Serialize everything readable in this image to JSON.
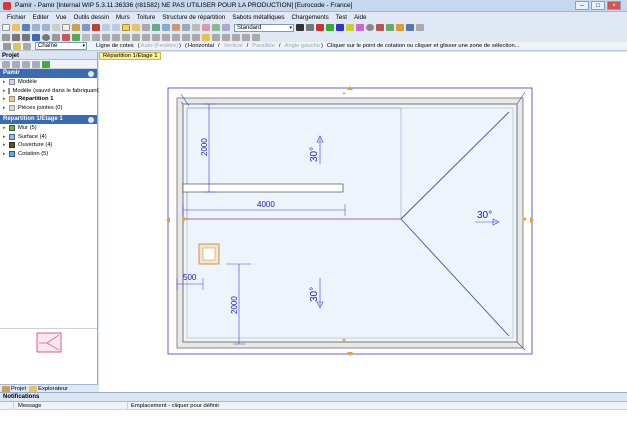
{
  "window": {
    "title": "Pamir - Pamir    [Internal WIP 5.3.11.36336 (r81582) NE PAS UTILISER POUR LA PRODUCTION]    [Eurocode - France]"
  },
  "menu": [
    "Fichier",
    "Editer",
    "Vue",
    "Outils dessin",
    "Murs",
    "Toiture",
    "Structure de répartition",
    "Sabots métalliques",
    "Chargements",
    "Test",
    "Aide"
  ],
  "toolbar": {
    "style_select": "Standard",
    "line_select": "Chaîne"
  },
  "options": {
    "tool_name": "Ligne de cotes",
    "item_auto": "Auto (Fenêtre)",
    "item_horizontal": "Horizontal",
    "item_vertical": "Vertical",
    "item_parallel": "Parallèle",
    "item_angle": "Angle gauche",
    "hint": "Cliquer sur le point de cotation ou cliquer et glisser une zone de sélection..."
  },
  "left_panel": {
    "project_header": "Projet",
    "pamir_section": "Pamir",
    "tree": [
      {
        "label": "Modèle"
      },
      {
        "label": "Modèle (sauvé dans le fabriquant)"
      },
      {
        "label": "Répartition 1"
      },
      {
        "label": "Pièces jointes (0)"
      }
    ],
    "repartition_section": "Répartition 1/Etage 1",
    "layers": [
      {
        "label": "Mur (5)",
        "icon": "wall-icon"
      },
      {
        "label": "Surface (4)",
        "icon": "surface-icon"
      },
      {
        "label": "Ouverture (4)",
        "icon": "opening-icon"
      },
      {
        "label": "Cotation (5)",
        "icon": "dimension-icon"
      }
    ],
    "tabs": [
      "Projet",
      "Explorateur"
    ]
  },
  "drawing": {
    "tab": "Répartition 1/Etage 1",
    "dim_2000_top": "2000",
    "dim_4000": "4000",
    "dim_500": "500",
    "dim_2000_bottom": "2000",
    "slope_top": "30°",
    "slope_right": "30°",
    "slope_bottom": "30°"
  },
  "notifications": {
    "header": "Notifications",
    "col_message": "Message",
    "col_location": "Emplacement - cliquer pour définir"
  }
}
